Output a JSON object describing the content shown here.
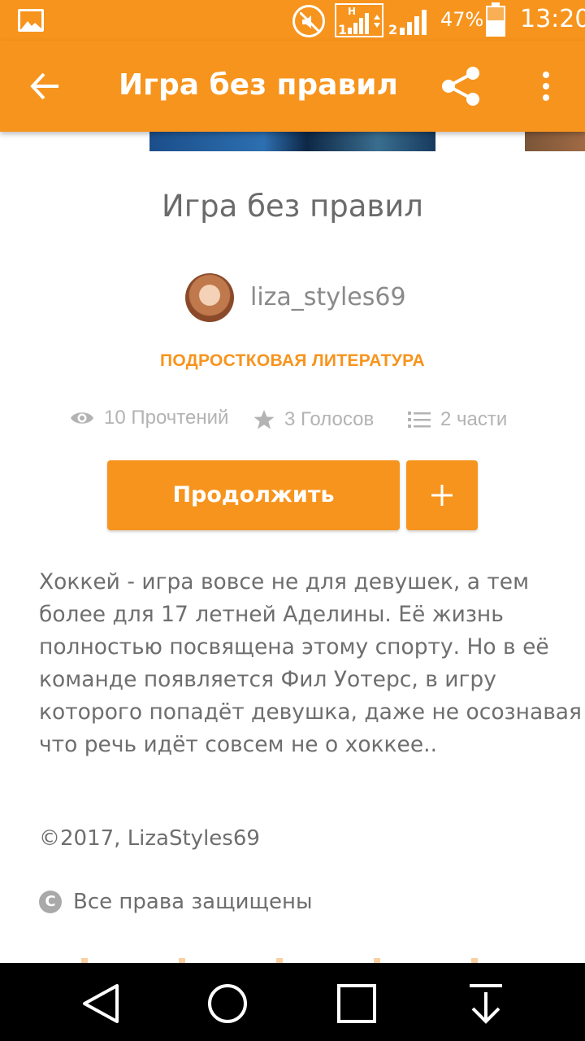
{
  "status_bar": {
    "battery_percent": "47%",
    "time": "13:20",
    "sim1_label": "1",
    "sim1_network": "H",
    "sim2_label": "2"
  },
  "toolbar": {
    "title": "Игра без правил"
  },
  "story": {
    "title": "Игра без правил",
    "author": "liza_styles69",
    "genre": "ПОДРОСТКОВАЯ ЛИТЕРАТУРА",
    "stats": {
      "reads": "10 Прочтений",
      "votes": "3 Голосов",
      "parts": "2 части"
    },
    "continue_label": "Продолжить",
    "description_lines": [
      "Хоккей - игра вовсе не для девушек, а тем",
      "более для 17 летней Аделины. Её жизнь",
      "полностью посвящена этому спорту. Но в её",
      "команде появляется Фил Уотерс, в игру",
      "которого попадёт девушка, даже не осознавая",
      "что речь идёт совсем не о хоккее.."
    ],
    "copyright": "©2017, LizaStyles69",
    "rights": "Все права защищены",
    "rights_icon_glyph": "C"
  },
  "colors": {
    "accent": "#f7941d",
    "text": "#6e6e6e",
    "muted": "#b3b3b3"
  },
  "icons": {
    "toolbar": [
      "back-arrow-icon",
      "share-icon",
      "more-vert-icon"
    ],
    "stats": [
      "eye-icon",
      "star-icon",
      "list-icon"
    ],
    "nav": [
      "back-triangle-icon",
      "home-circle-icon",
      "recents-square-icon",
      "download-arrow-icon"
    ]
  }
}
